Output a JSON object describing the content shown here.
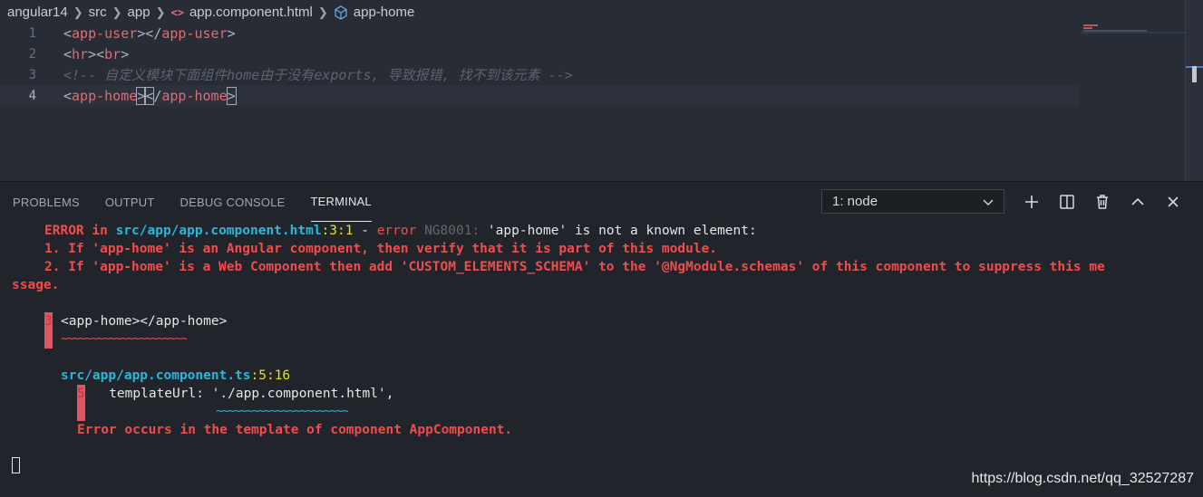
{
  "breadcrumb": {
    "items": [
      "angular14",
      "src",
      "app",
      "app.component.html",
      "app-home"
    ],
    "file_icon_glyph": "<>"
  },
  "editor": {
    "lines": [
      {
        "number": "1",
        "tag_open_lt": "<",
        "tag_name": "app-user",
        "mid": "></",
        "tag_name2": "app-user",
        "gt": ">"
      },
      {
        "number": "2",
        "text_a": "hr",
        "text_b": "br"
      },
      {
        "number": "3",
        "comment": "<!-- 自定义模块下面组件home由于没有exports, 导致报错, 找不到该元素 -->"
      },
      {
        "number": "4",
        "tag_name": "app-home",
        "tag_name2": "app-home"
      }
    ]
  },
  "panel": {
    "tabs": [
      "PROBLEMS",
      "OUTPUT",
      "DEBUG CONSOLE",
      "TERMINAL"
    ],
    "active_tab": "TERMINAL",
    "terminal_select": "1: node"
  },
  "terminal": {
    "err_prefix": "ERROR in ",
    "err_file": "src/app/app.component.html",
    "err_loc": ":3:1",
    "err_dash": " - ",
    "err_word": "error",
    "err_code": " NG8001:",
    "err_msg": " 'app-home' is not a known element:",
    "line1": "1. If 'app-home' is an Angular component, then verify that it is part of this module.",
    "line2": "2. If 'app-home' is a Web Component then add 'CUSTOM_ELEMENTS_SCHEMA' to the '@NgModule.schemas' of this component to suppress this me",
    "line2b": "ssage.",
    "snippet_num": "3",
    "snippet": "<app-home></app-home>",
    "snippet_squiggle": "~~~~~~~~~~~~~~~~~~~~~",
    "ref_file": "src/app/app.component.ts",
    "ref_loc": ":5:16",
    "ref_num": "5",
    "ref_code": "   templateUrl: './app.component.html',",
    "ref_squiggle": "~~~~~~~~~~~~~~~~~~~~~~",
    "final": "Error occurs in the template of component AppComponent."
  },
  "watermark": "https://blog.csdn.net/qq_32527287",
  "colors": {
    "bg": "#282c34",
    "panel_bg": "#21252b",
    "tag": "#e06c75",
    "comment": "#5c6370",
    "term_red": "#f14c4c",
    "term_cyan": "#29b8db",
    "term_yellow": "#e5e510"
  }
}
